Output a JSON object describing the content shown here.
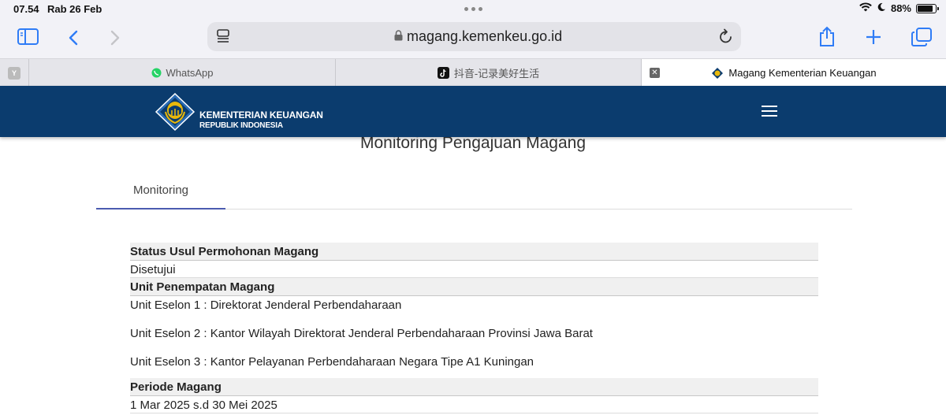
{
  "status_bar": {
    "time": "07.54",
    "date": "Rab 26 Feb",
    "battery": "88%",
    "battery_level": 0.88
  },
  "browser": {
    "url": "magang.kemenkeu.go.id",
    "tabs": [
      {
        "label": "WhatsApp",
        "icon": "whatsapp-icon"
      },
      {
        "label": "抖音-记录美好生活",
        "icon": "tiktok-icon"
      },
      {
        "label": "Magang Kementerian Keuangan",
        "icon": "kemenkeu-favicon",
        "active": true
      }
    ]
  },
  "site": {
    "brand_title": "KEMENTERIAN KEUANGAN",
    "brand_sub": "REPUBLIK INDONESIA",
    "brand_color": "#0b3c6e"
  },
  "page": {
    "title": "Monitoring Pengajuan Magang",
    "tab": "Monitoring",
    "status_heading": "Status Usul Permohonan Magang",
    "status_value": "Disetujui",
    "unit_heading": "Unit Penempatan Magang",
    "units": [
      "Unit Eselon 1 : Direktorat Jenderal Perbendaharaan",
      "Unit Eselon 2 : Kantor Wilayah Direktorat Jenderal Perbendaharaan Provinsi Jawa Barat",
      "Unit Eselon 3 : Kantor Pelayanan Perbendaharaan Negara Tipe A1 Kuningan"
    ],
    "period_heading": "Periode Magang",
    "period_value": "1 Mar 2025 s.d 30 Mei 2025"
  }
}
